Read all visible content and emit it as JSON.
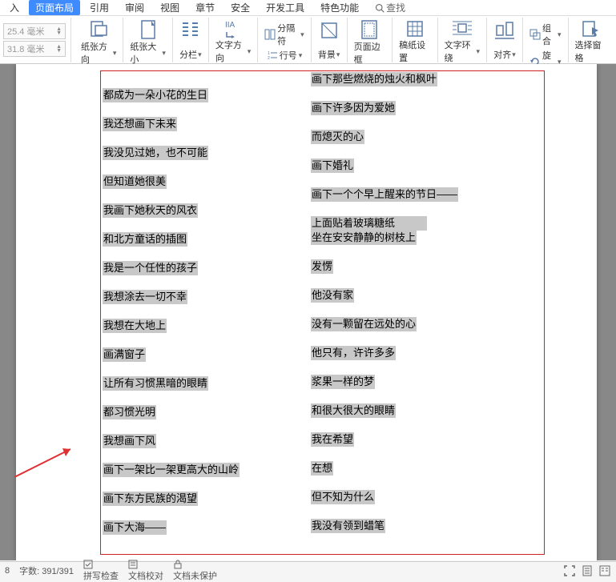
{
  "tabs": {
    "insert": "入",
    "page_layout": "页面布局",
    "references": "引用",
    "review": "审阅",
    "view": "视图",
    "chapter": "章节",
    "security": "安全",
    "dev_tools": "开发工具",
    "features": "特色功能",
    "search": "查找"
  },
  "ribbon": {
    "width_value": "25.4 毫米",
    "height_value": "31.8 毫米",
    "orientation": "纸张方向",
    "size": "纸张大小",
    "columns": "分栏",
    "direction": "文字方向",
    "separator": "分隔符",
    "line_number": "行号",
    "background": "背景",
    "page_border": "页面边框",
    "letterhead": "稿纸设置",
    "text_wrap": "文字环绕",
    "align": "对齐",
    "group": "组合",
    "rotate": "旋转",
    "select_pane": "选择窗格"
  },
  "content": {
    "col1": [
      "都成为一朵小花的生日",
      "我还想画下未来",
      "我没见过她，也不可能",
      "但知道她很美",
      "我画下她秋天的风衣",
      "和北方童话的插图",
      "我是一个任性的孩子",
      "我想涂去一切不幸",
      "我想在大地上",
      "画满窗子",
      "让所有习惯黑暗的眼睛",
      "都习惯光明",
      "我想画下风",
      "画下一架比一架更高大的山岭",
      "画下东方民族的渴望",
      "画下大海——"
    ],
    "col2": [
      "画下那些燃烧的烛火和枫叶",
      "画下许多因为爱她",
      "而熄灭的心",
      "画下婚礼",
      "画下一个个早上醒来的节日——",
      "上面贴着玻璃糖纸",
      "坐在安安静静的树枝上",
      "发愣",
      "他没有家",
      "没有一颗留在远处的心",
      "他只有，许许多多",
      "浆果一样的梦",
      "和很大很大的眼睛",
      "我在希望",
      "在想",
      "但不知为什么",
      "我没有领到蜡笔"
    ]
  },
  "status": {
    "page": "8",
    "words": "字数: 391/391",
    "spellcheck": "拼写检查",
    "proofing": "文档校对",
    "protection": "文档未保护"
  }
}
